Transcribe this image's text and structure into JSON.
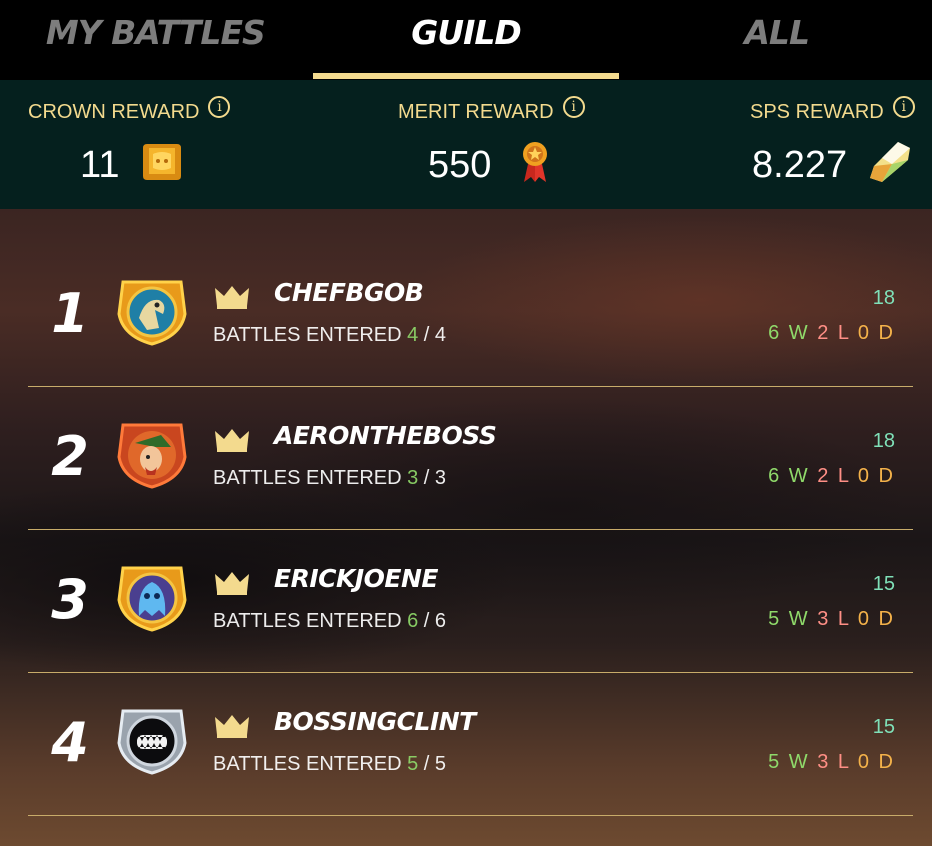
{
  "tabs": [
    {
      "label": "MY BATTLES",
      "active": false
    },
    {
      "label": "GUILD",
      "active": true
    },
    {
      "label": "ALL",
      "active": false
    }
  ],
  "rewards": {
    "crown": {
      "label": "CROWN REWARD",
      "value": "11",
      "icon": "crown-token-icon"
    },
    "merit": {
      "label": "MERIT REWARD",
      "value": "550",
      "icon": "merit-medal-icon"
    },
    "sps": {
      "label": "SPS REWARD",
      "value": "8.227",
      "icon": "sps-crystal-icon"
    },
    "info_glyph": "i"
  },
  "players": [
    {
      "rank": "1",
      "name": "CHEFBGOB",
      "battles_label": "BATTLES ENTERED",
      "entered": "4",
      "total": "4",
      "score": "18",
      "wins": "6",
      "losses": "2",
      "draws": "0",
      "avatar": "avatar-blue-bird"
    },
    {
      "rank": "2",
      "name": "AERONTHEBOSS",
      "battles_label": "BATTLES ENTERED",
      "entered": "3",
      "total": "3",
      "score": "18",
      "wins": "6",
      "losses": "2",
      "draws": "0",
      "avatar": "avatar-red-archer"
    },
    {
      "rank": "3",
      "name": "ERICKJOENE",
      "battles_label": "BATTLES ENTERED",
      "entered": "6",
      "total": "6",
      "score": "15",
      "wins": "5",
      "losses": "3",
      "draws": "0",
      "avatar": "avatar-blue-ghost"
    },
    {
      "rank": "4",
      "name": "BOSSINGCLINT",
      "battles_label": "BATTLES ENTERED",
      "entered": "5",
      "total": "5",
      "score": "15",
      "wins": "5",
      "losses": "3",
      "draws": "0",
      "avatar": "avatar-black-monster"
    }
  ],
  "wld_suffix": {
    "w": "W",
    "l": "L",
    "d": "D"
  },
  "colors": {
    "accent_gold": "#f3da8e",
    "reward_bar": "#05201e",
    "win": "#8fd96a",
    "loss": "#ff8f86",
    "draw": "#f4b24a",
    "score": "#7fe0b8"
  }
}
